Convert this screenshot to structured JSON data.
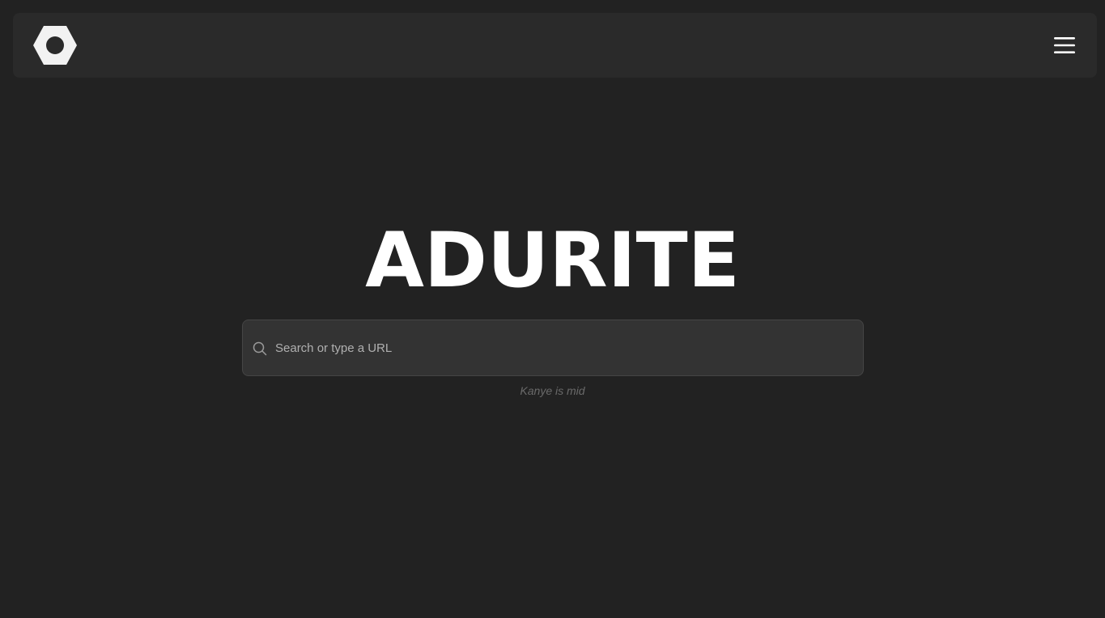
{
  "app": {
    "title": "ADURITE"
  },
  "navbar": {
    "logo_icon": "hexagon-logo-icon",
    "menu_icon": "hamburger-menu-icon"
  },
  "search": {
    "placeholder": "Search or type a URL",
    "value": "",
    "icon": "search-icon"
  },
  "tagline": "Kanye is mid",
  "colors": {
    "background": "#222222",
    "navbar": "#2a2a2a",
    "search_box": "#333333",
    "title": "#ffffff",
    "tagline": "#6a6a6a"
  }
}
